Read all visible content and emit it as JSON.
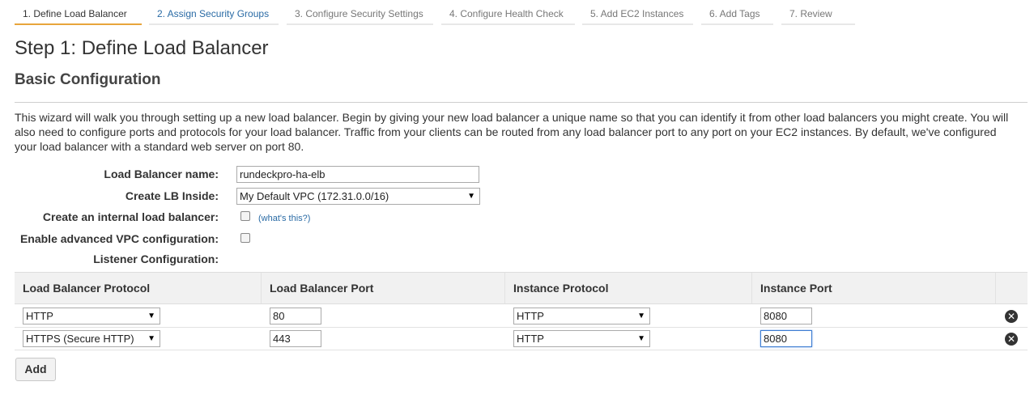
{
  "wizard_tabs": [
    {
      "label": "1. Define Load Balancer",
      "state": "active"
    },
    {
      "label": "2. Assign Security Groups",
      "state": "link"
    },
    {
      "label": "3. Configure Security Settings",
      "state": "inactive"
    },
    {
      "label": "4. Configure Health Check",
      "state": "inactive"
    },
    {
      "label": "5. Add EC2 Instances",
      "state": "inactive"
    },
    {
      "label": "6. Add Tags",
      "state": "inactive"
    },
    {
      "label": "7. Review",
      "state": "inactive"
    }
  ],
  "page": {
    "title": "Step 1: Define Load Balancer",
    "section_title": "Basic Configuration",
    "description": "This wizard will walk you through setting up a new load balancer. Begin by giving your new load balancer a unique name so that you can identify it from other load balancers you might create. You will also need to configure ports and protocols for your load balancer. Traffic from your clients can be routed from any load balancer port to any port on your EC2 instances. By default, we've configured your load balancer with a standard web server on port 80."
  },
  "form": {
    "lb_name_label": "Load Balancer name:",
    "lb_name_value": "rundeckpro-ha-elb",
    "create_inside_label": "Create LB Inside:",
    "create_inside_value": "My Default VPC (172.31.0.0/16)",
    "internal_label": "Create an internal load balancer:",
    "internal_checked": false,
    "whats_this": "(what's this?)",
    "advanced_vpc_label": "Enable advanced VPC configuration:",
    "advanced_vpc_checked": false,
    "listener_label": "Listener Configuration:"
  },
  "listeners": {
    "headers": [
      "Load Balancer Protocol",
      "Load Balancer Port",
      "Instance Protocol",
      "Instance Port"
    ],
    "rows": [
      {
        "lb_protocol": "HTTP",
        "lb_port": "80",
        "instance_protocol": "HTTP",
        "instance_port": "8080"
      },
      {
        "lb_protocol": "HTTPS (Secure HTTP)",
        "lb_port": "443",
        "instance_protocol": "HTTP",
        "instance_port": "8080"
      }
    ],
    "add_label": "Add"
  },
  "colors": {
    "active_tab_underline": "#e8a53c",
    "link": "#2a6ba5"
  },
  "icons": {
    "select_caret": "▼",
    "remove": "✕"
  }
}
